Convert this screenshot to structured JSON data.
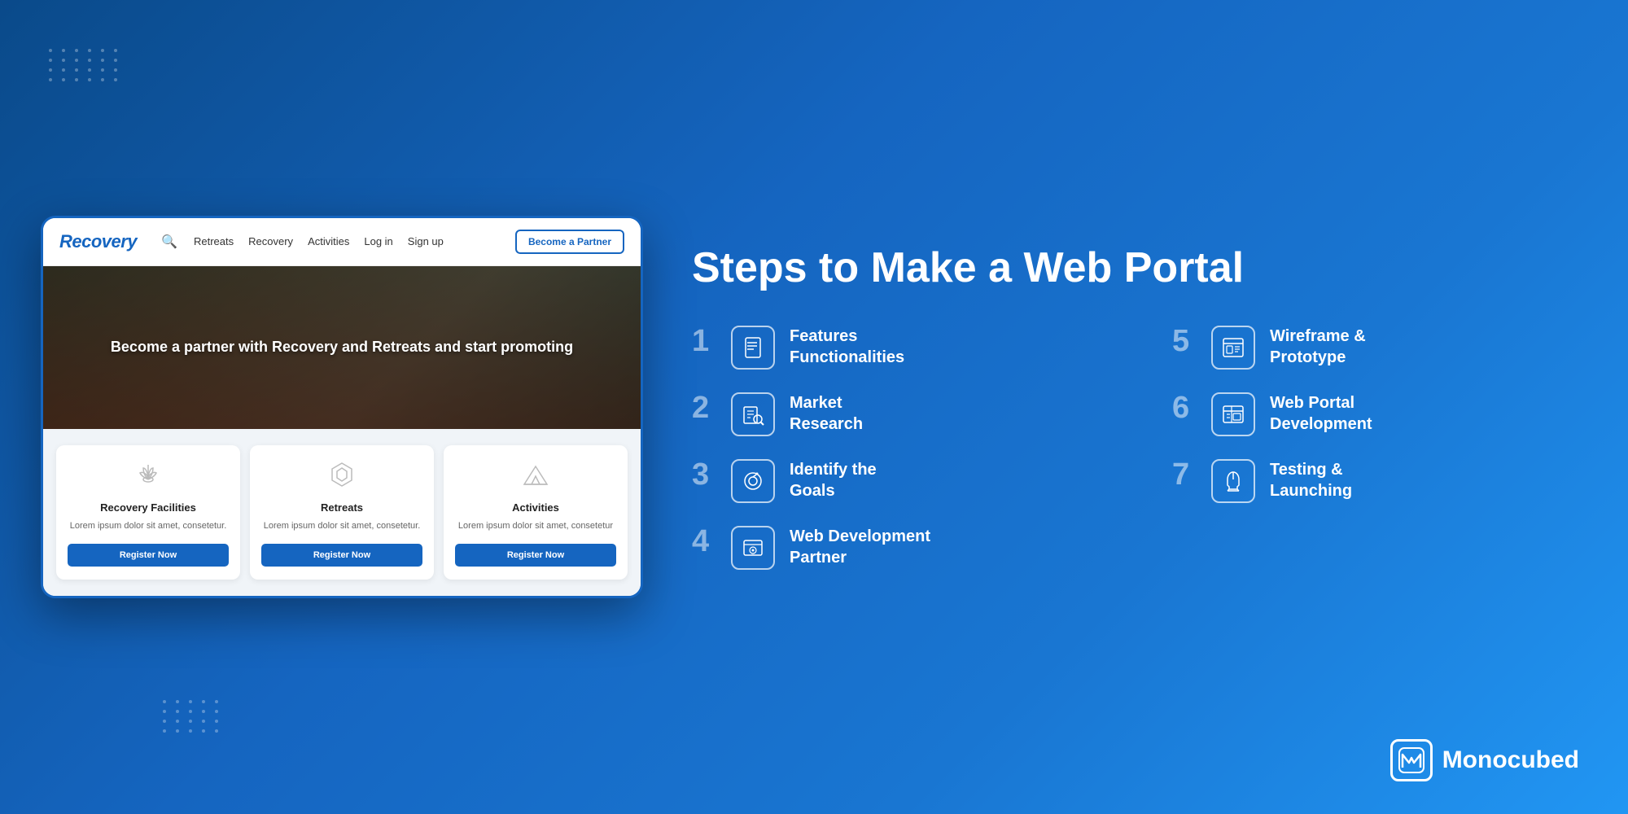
{
  "background": {
    "gradient_start": "#0a4a8a",
    "gradient_end": "#2196f3"
  },
  "mockup": {
    "logo": "Recovery",
    "nav": {
      "links": [
        "Retreats",
        "Recovery",
        "Activities",
        "Log in",
        "Sign up"
      ],
      "cta_label": "Become a Partner"
    },
    "hero": {
      "text": "Become a partner with Recovery and Retreats and start promoting"
    },
    "cards": [
      {
        "title": "Recovery Facilities",
        "description": "Lorem ipsum dolor sit amet, consetetur.",
        "button": "Register Now",
        "icon": "🪷"
      },
      {
        "title": "Retreats",
        "description": "Lorem ipsum dolor sit amet, consetetur.",
        "button": "Register Now",
        "icon": "⬡"
      },
      {
        "title": "Activities",
        "description": "Lorem ipsum dolor sit amet, consetetur",
        "button": "Register Now",
        "icon": "⛺"
      }
    ]
  },
  "steps_section": {
    "title": "Steps to Make a Web Portal",
    "steps": [
      {
        "number": "1",
        "label": "Features\nFunctionalities",
        "icon": "📋"
      },
      {
        "number": "5",
        "label": "Wireframe &\nPrototype",
        "icon": "🖼"
      },
      {
        "number": "2",
        "label": "Market\nResearch",
        "icon": "📊"
      },
      {
        "number": "6",
        "label": "Web Portal\nDevelopment",
        "icon": "🖥"
      },
      {
        "number": "3",
        "label": "Identify the\nGoals",
        "icon": "🎯"
      },
      {
        "number": "7",
        "label": "Testing &\nLaunching",
        "icon": "🚀"
      },
      {
        "number": "4",
        "label": "Web Development\nPartner",
        "icon": "⚙"
      }
    ]
  },
  "branding": {
    "name": "Monocubed",
    "logo_letter": "M"
  }
}
